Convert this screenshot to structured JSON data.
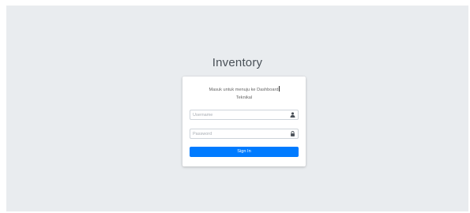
{
  "app": {
    "brand": "Inventory"
  },
  "login": {
    "message_line1": "Masuk untuk menuju ke Dashboard",
    "message_line2": "Teknikal",
    "username_placeholder": "Username",
    "username_icon": "user-icon",
    "password_placeholder": "Password",
    "password_icon": "lock-icon",
    "submit_label": "Sign In"
  },
  "colors": {
    "background": "#e9ecef",
    "card": "#ffffff",
    "primary": "#007bff"
  }
}
